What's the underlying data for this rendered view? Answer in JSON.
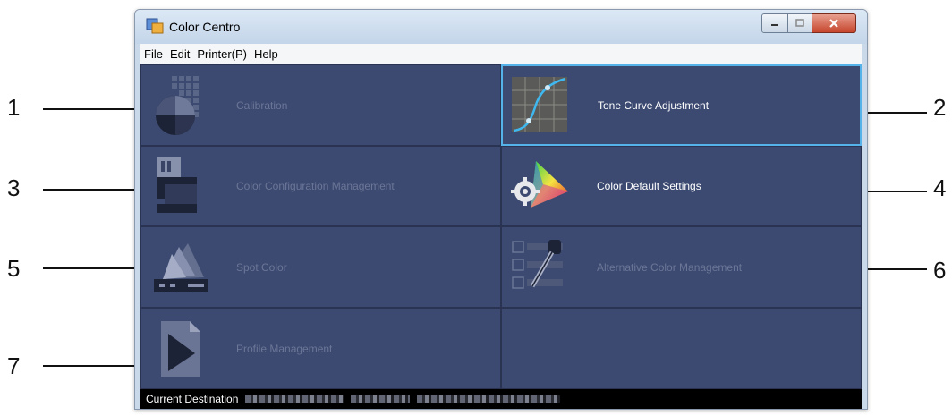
{
  "window": {
    "title": "Color Centro"
  },
  "menu": {
    "items": [
      "File",
      "Edit",
      "Printer(P)",
      "Help"
    ]
  },
  "tiles": [
    {
      "label": "Calibration",
      "icon": "calibration-icon",
      "enabled": false
    },
    {
      "label": "Tone Curve Adjustment",
      "icon": "tone-curve-icon",
      "enabled": true
    },
    {
      "label": "Color Configuration Management",
      "icon": "color-configuration-icon",
      "enabled": false
    },
    {
      "label": "Color Default Settings",
      "icon": "color-default-settings-icon",
      "enabled": true
    },
    {
      "label": "Spot Color",
      "icon": "spot-color-icon",
      "enabled": false
    },
    {
      "label": "Alternative Color Management",
      "icon": "alternative-color-icon",
      "enabled": false
    },
    {
      "label": "Profile Management",
      "icon": "profile-management-icon",
      "enabled": false
    }
  ],
  "callouts": [
    "1",
    "2",
    "3",
    "4",
    "5",
    "6",
    "7"
  ],
  "status": {
    "label": "Current Destination"
  },
  "colors": {
    "tile_bg": "#3c4a72",
    "grid_bg": "#2b3554",
    "active_border": "#56b3e9",
    "disabled_text": "#6c7696"
  }
}
